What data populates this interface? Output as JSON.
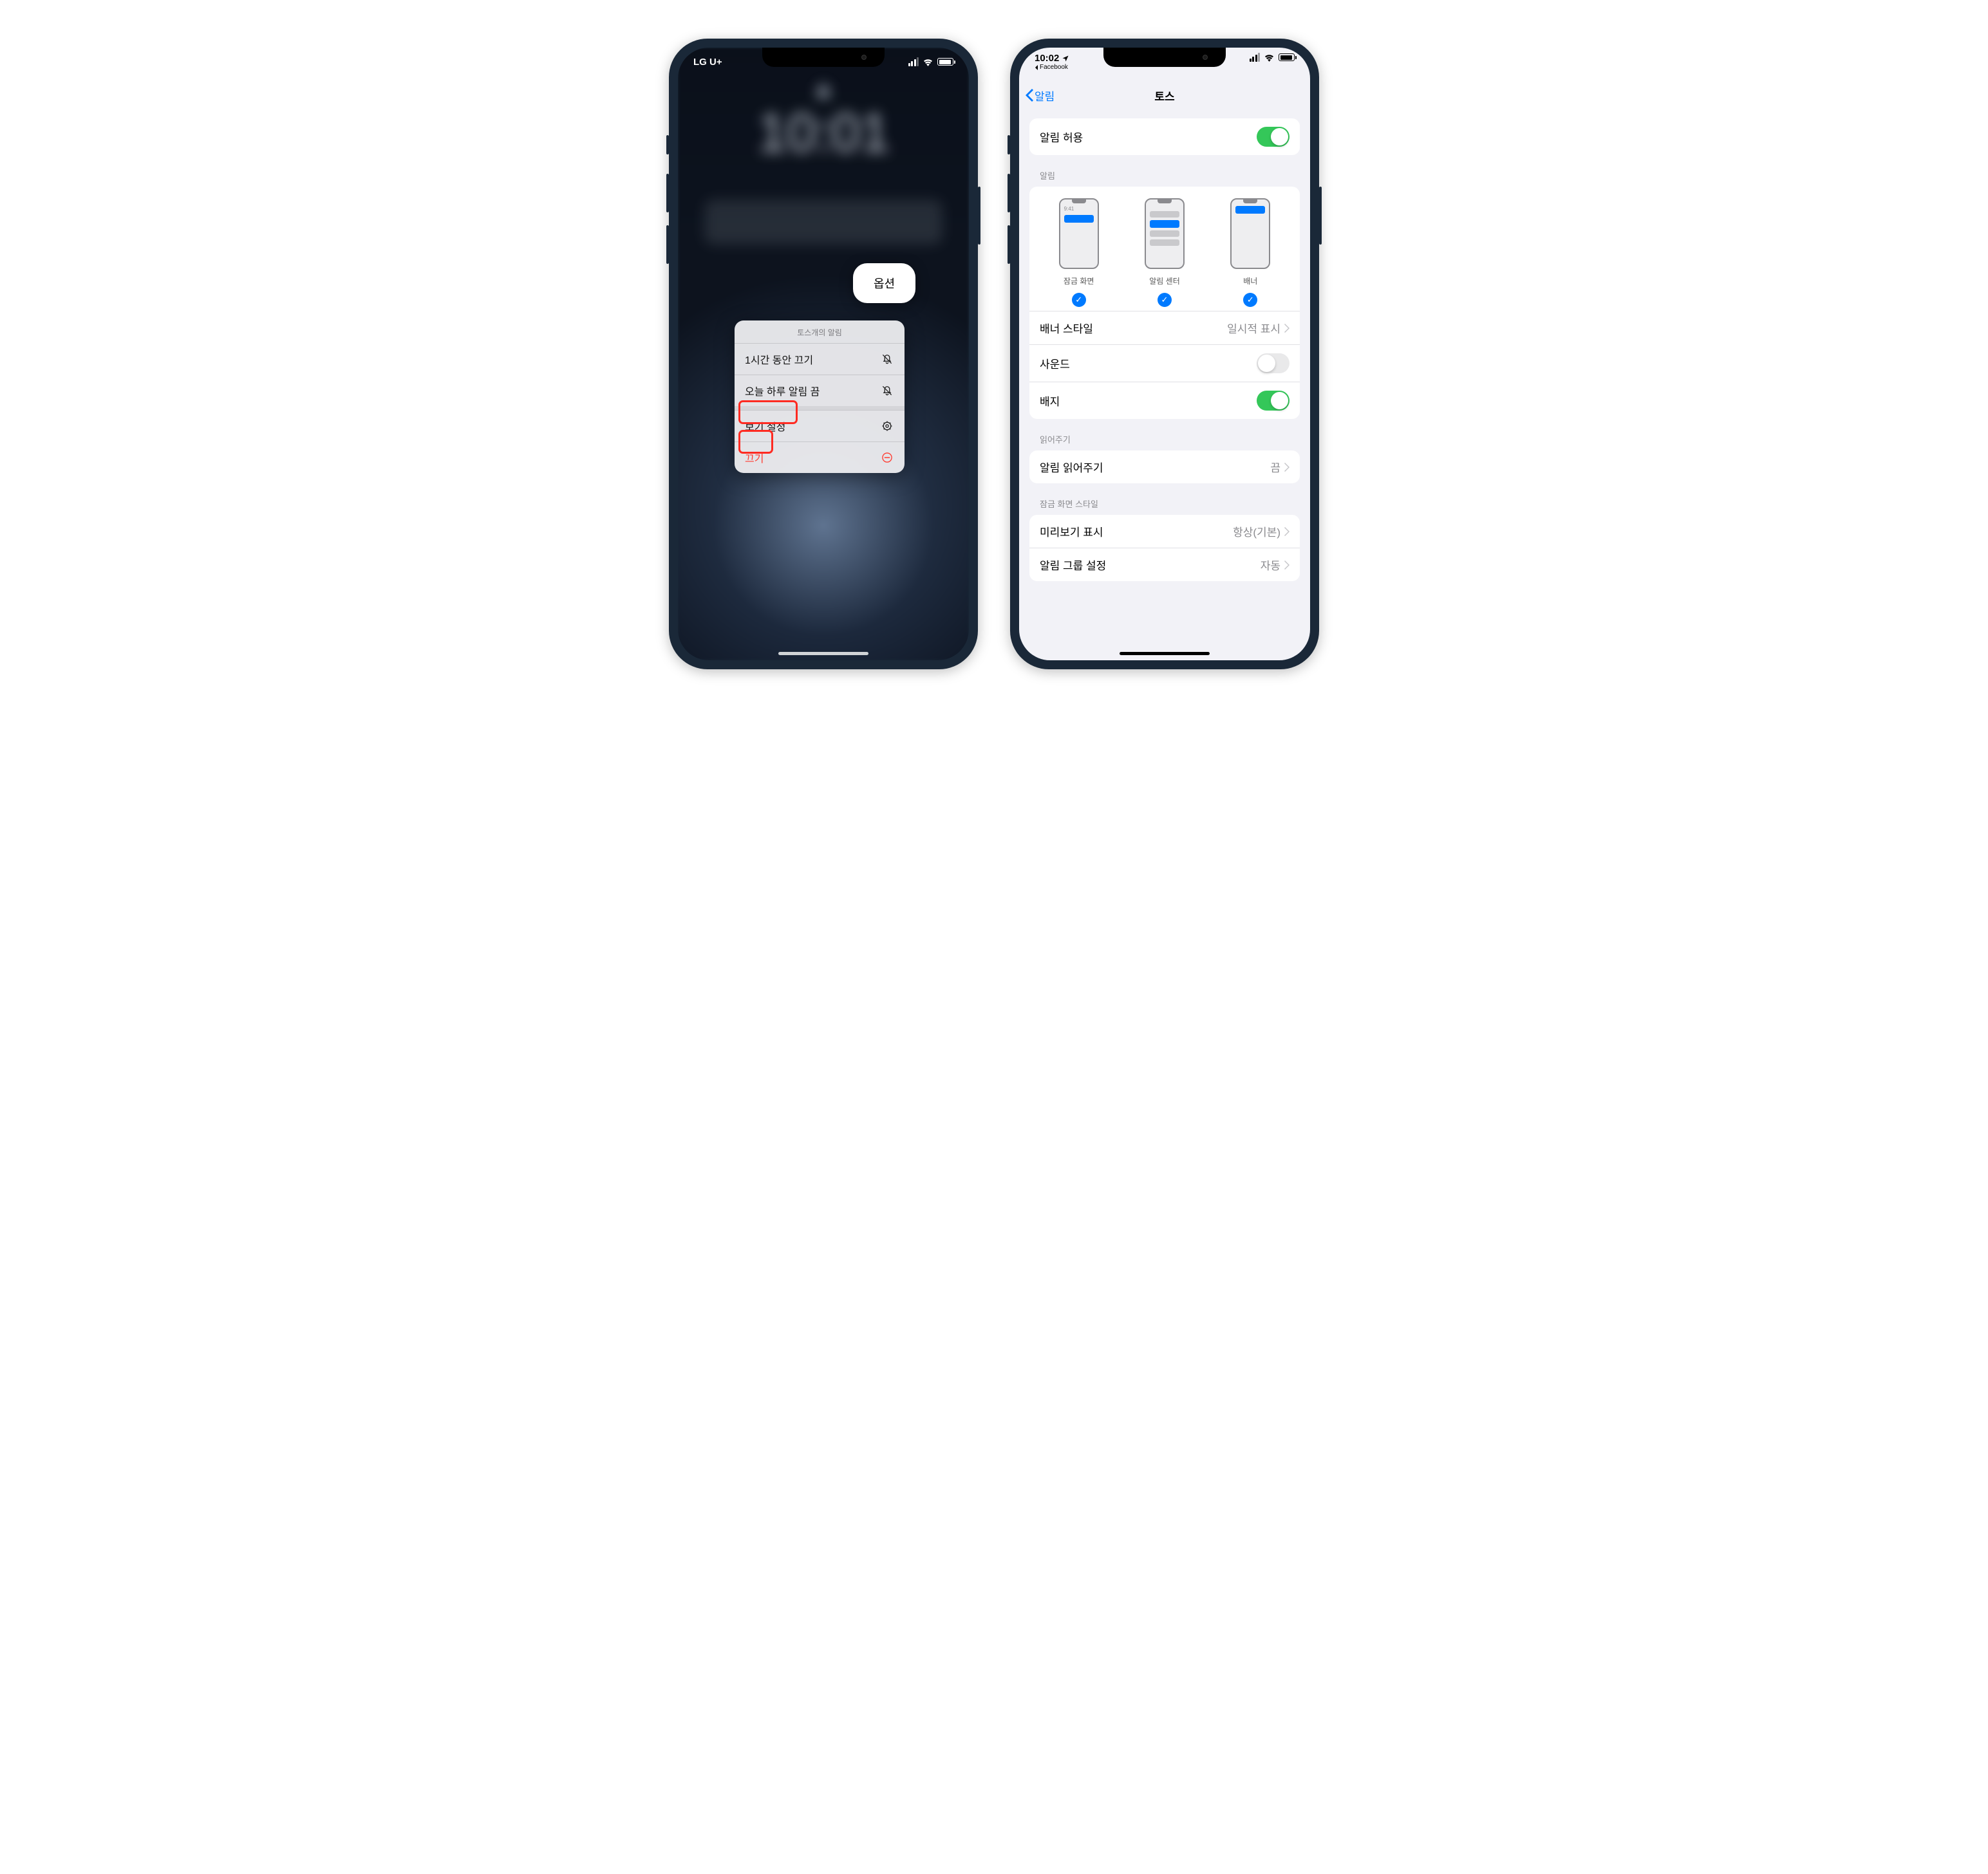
{
  "phone1": {
    "carrier": "LG U+",
    "lock_time": "10:01",
    "options_label": "옵션",
    "menu": {
      "header": "토스개의 알림",
      "mute_1h": "1시간 동안 끄기",
      "mute_today": "오늘 하루 알림 끔",
      "view_settings": "보기 설정",
      "turn_off": "끄기"
    }
  },
  "phone2": {
    "time": "10:02",
    "back_app": "Facebook",
    "nav_back": "알림",
    "nav_title": "토스",
    "allow_notifications": "알림 허용",
    "section_alerts": "알림",
    "previews": {
      "lock_screen": "잠금 화면",
      "notification_center": "알림 센터",
      "banners": "배너",
      "mini_time": "9:41"
    },
    "banner_style": {
      "label": "배너 스타일",
      "value": "일시적 표시"
    },
    "sounds": "사운드",
    "badges": "배지",
    "section_announce": "읽어주기",
    "announce": {
      "label": "알림 읽어주기",
      "value": "끔"
    },
    "section_lockstyle": "잠금 화면 스타일",
    "preview_show": {
      "label": "미리보기 표시",
      "value": "항상(기본)"
    },
    "grouping": {
      "label": "알림 그룹 설정",
      "value": "자동"
    }
  }
}
